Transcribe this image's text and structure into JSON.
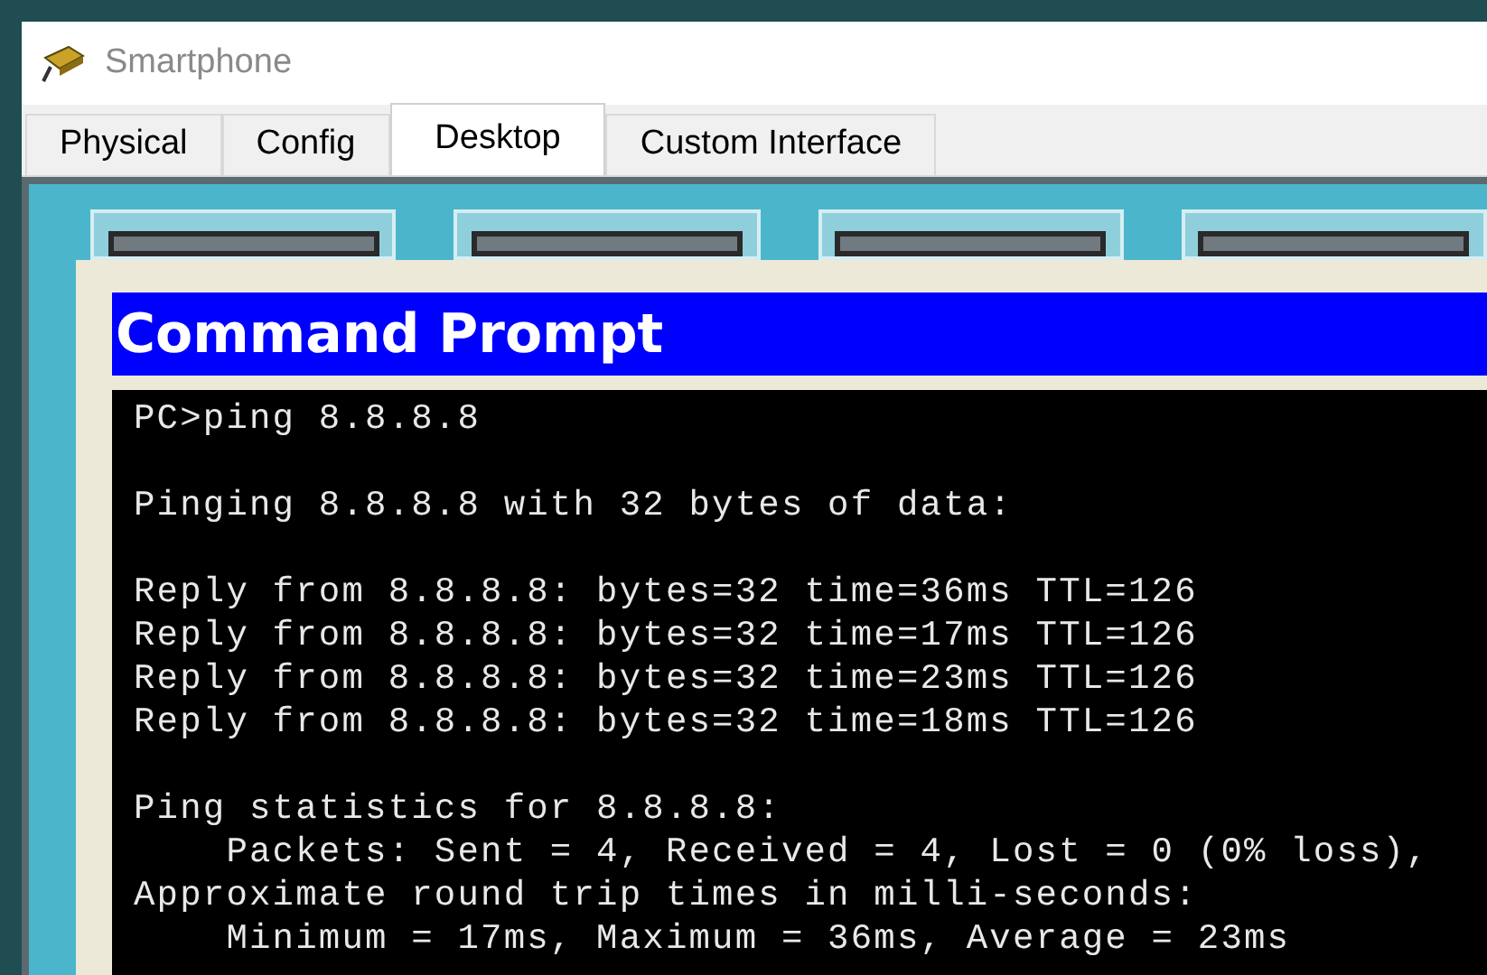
{
  "window": {
    "title": "Smartphone"
  },
  "tabs": [
    {
      "label": "Physical",
      "selected": false
    },
    {
      "label": "Config",
      "selected": false
    },
    {
      "label": "Desktop",
      "selected": true
    },
    {
      "label": "Custom Interface",
      "selected": false
    }
  ],
  "command_prompt": {
    "title": "Command Prompt",
    "blocks": [
      [
        "PC>ping 8.8.8.8"
      ],
      [
        "Pinging 8.8.8.8 with 32 bytes of data:"
      ],
      [
        "Reply from 8.8.8.8: bytes=32 time=36ms TTL=126",
        "Reply from 8.8.8.8: bytes=32 time=17ms TTL=126",
        "Reply from 8.8.8.8: bytes=32 time=23ms TTL=126",
        "Reply from 8.8.8.8: bytes=32 time=18ms TTL=126"
      ],
      [
        "Ping statistics for 8.8.8.8:",
        "    Packets: Sent = 4, Received = 4, Lost = 0 (0% loss),",
        "Approximate round trip times in milli-seconds:",
        "    Minimum = 17ms, Maximum = 36ms, Average = 23ms"
      ]
    ]
  }
}
